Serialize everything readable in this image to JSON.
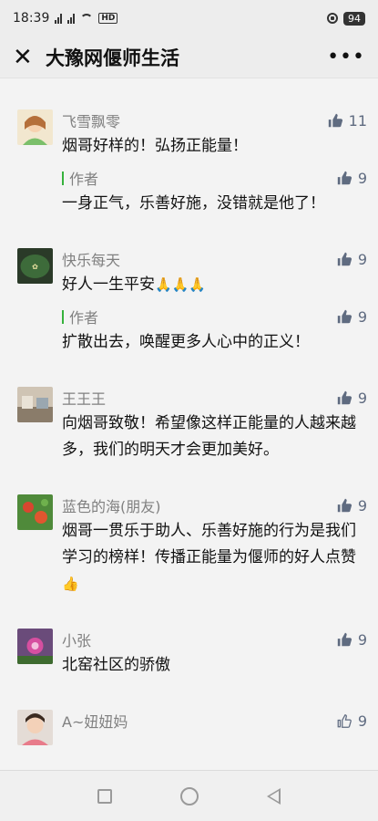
{
  "status": {
    "time": "18:39",
    "battery": "94",
    "network": "HD"
  },
  "header": {
    "title": "大豫网偃师生活"
  },
  "colors": {
    "accent_green": "#36b13c",
    "like_blue": "#5f6b80"
  },
  "comments": [
    {
      "name": "飞雪飘零",
      "likes": "11",
      "text": "烟哥好样的！弘扬正能量！",
      "reply": {
        "label": "作者",
        "likes": "9",
        "text": "一身正气，乐善好施，没错就是他了！"
      }
    },
    {
      "name": "快乐每天",
      "likes": "9",
      "text": "好人一生平安",
      "emoji": "🙏🙏🙏",
      "reply": {
        "label": "作者",
        "likes": "9",
        "text": "扩散出去，唤醒更多人心中的正义！"
      }
    },
    {
      "name": "王王王",
      "likes": "9",
      "text": "向烟哥致敬！希望像这样正能量的人越来越多，我们的明天才会更加美好。"
    },
    {
      "name": "蓝色的海(朋友)",
      "likes": "9",
      "text": "烟哥一贯乐于助人、乐善好施的行为是我们学习的榜样！传播正能量为偃师的好人点赞",
      "emoji": "👍"
    },
    {
      "name": "小张",
      "likes": "9",
      "text": "北窑社区的骄傲"
    },
    {
      "name": "A~妞妞妈",
      "likes": "9",
      "text": ""
    }
  ]
}
